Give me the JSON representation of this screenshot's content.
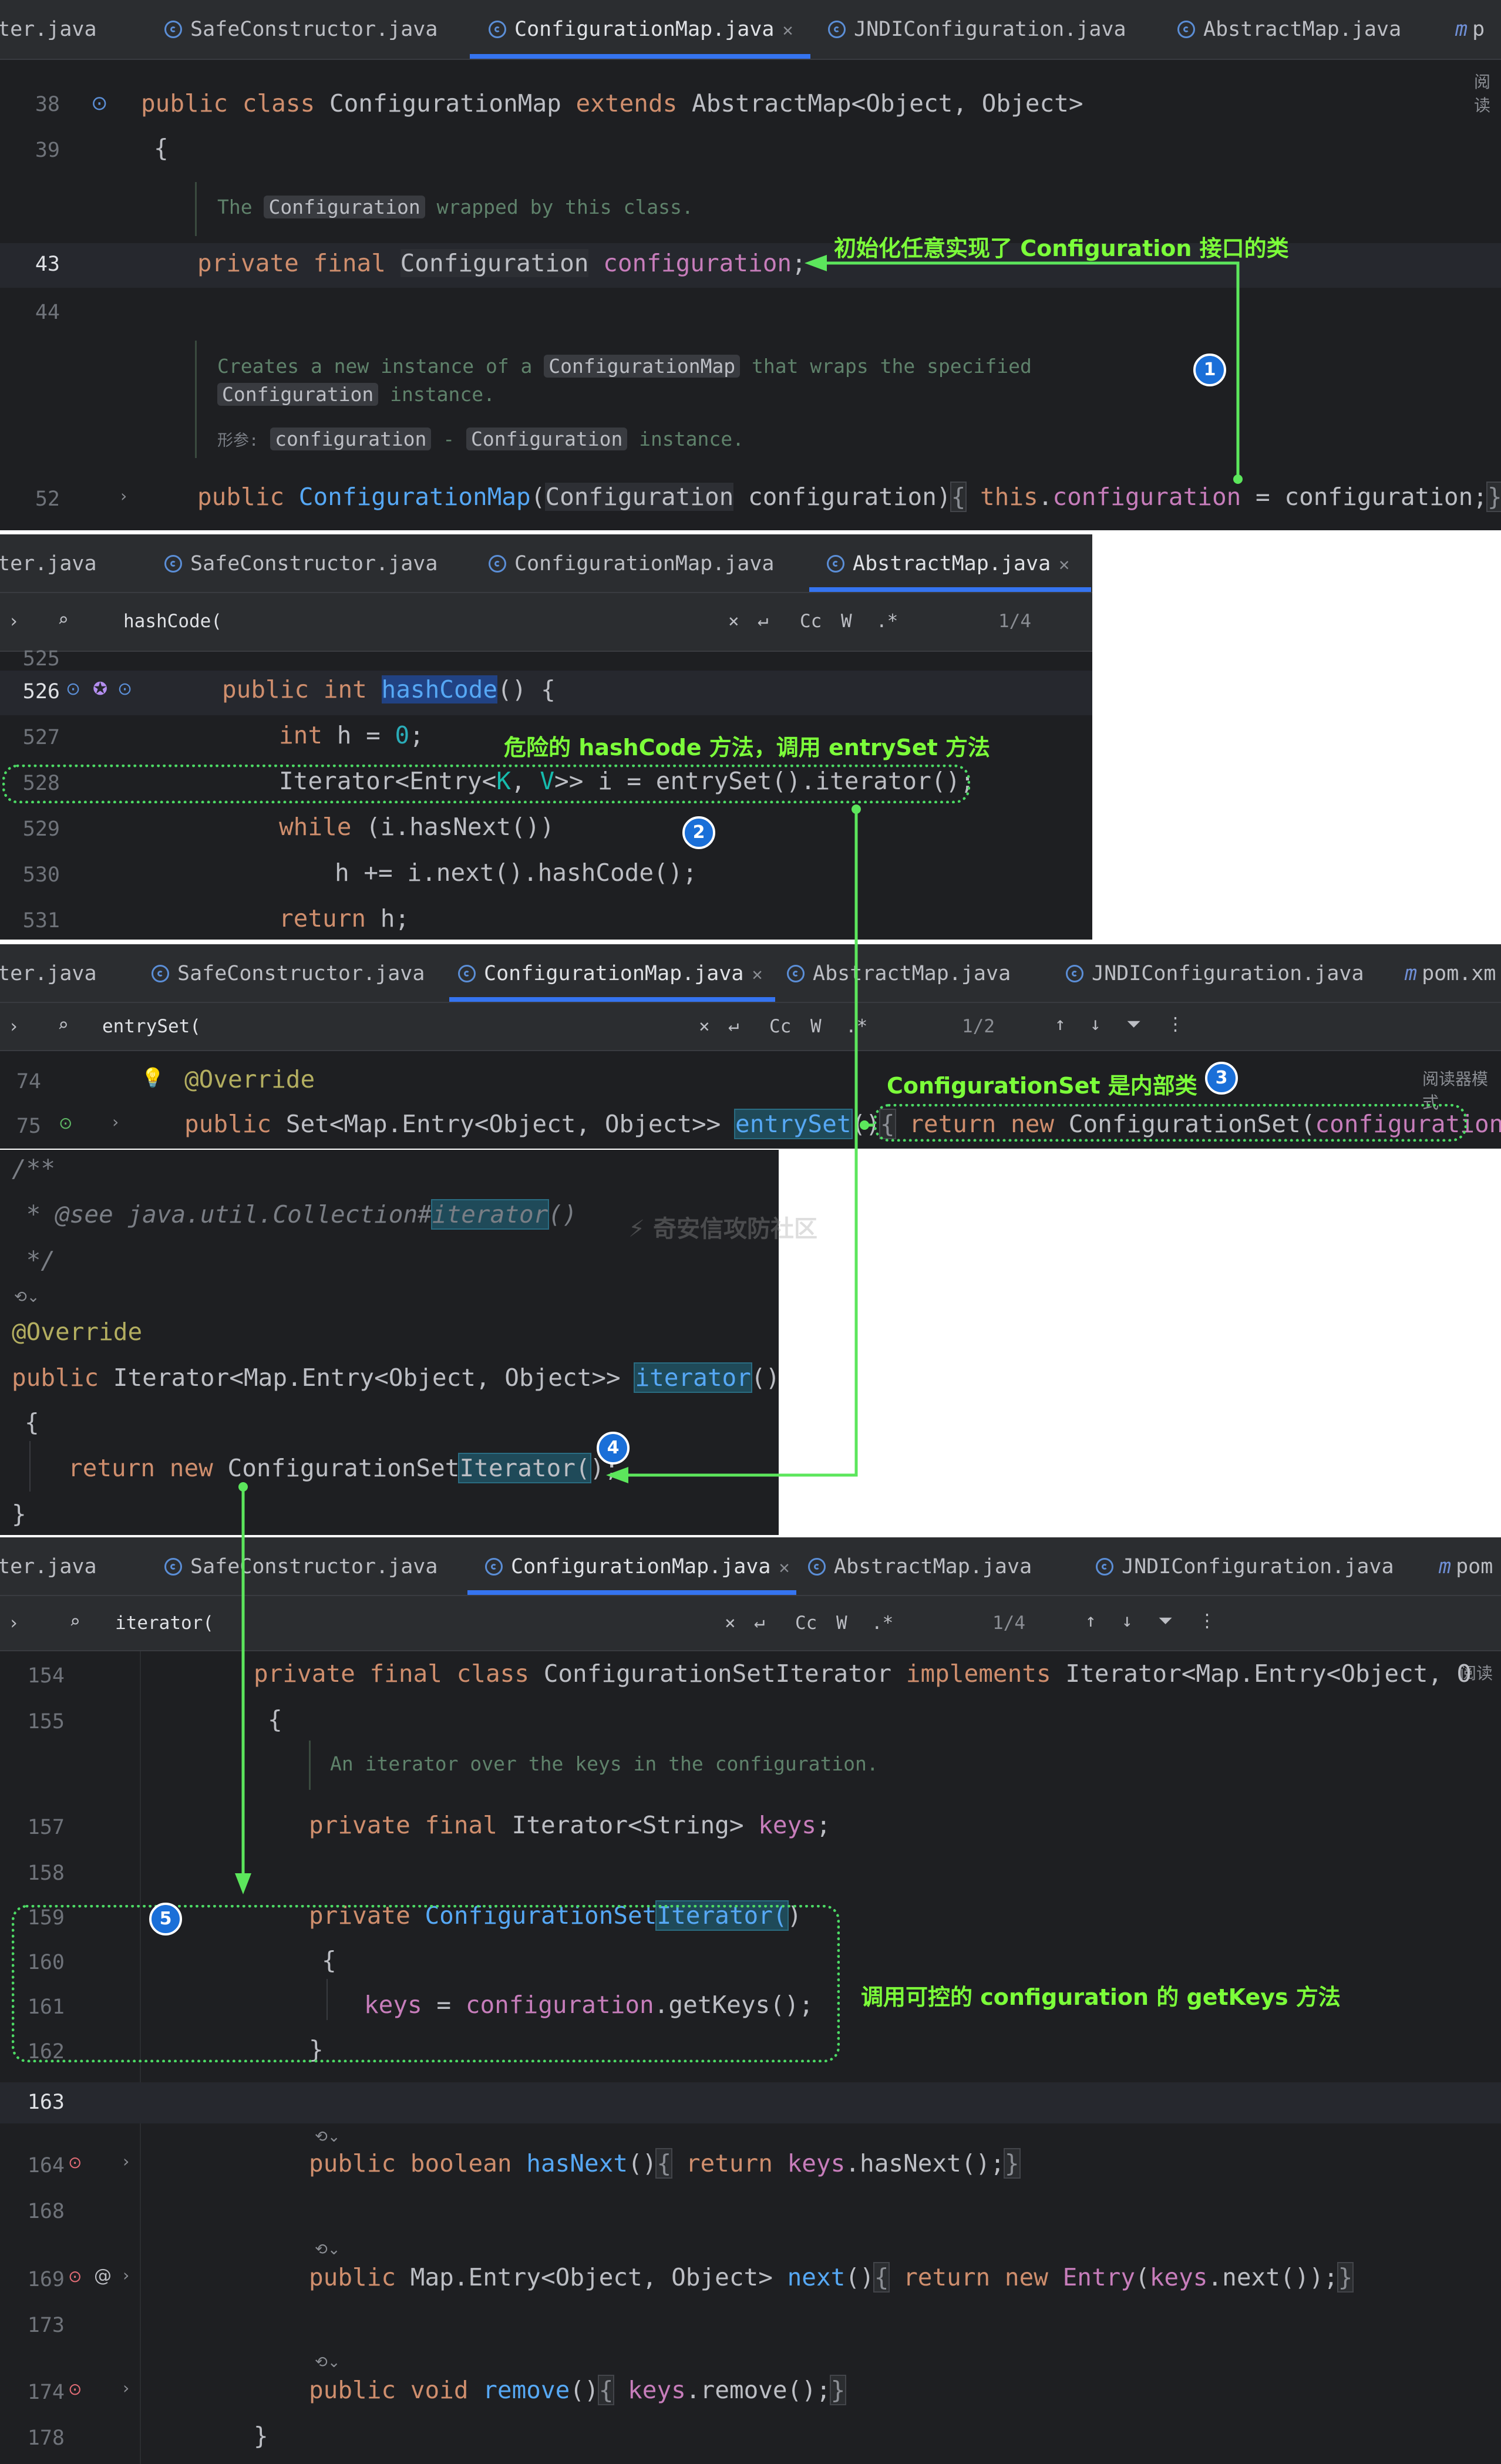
{
  "panel1": {
    "tabs": [
      "ter.java",
      "SafeConstructor.java",
      "ConfigurationMap.java",
      "JNDIConfiguration.java",
      "AbstractMap.java",
      "p"
    ],
    "tab_icon_m": "m",
    "right_hint": "阅读",
    "line_numbers": [
      "38",
      "39",
      "43",
      "44",
      "52"
    ],
    "doc1": {
      "pre": "The ",
      "chip": "Configuration",
      "post": " wrapped by this class."
    },
    "doc2": {
      "pre": "Creates a new instance of a ",
      "chip1": "ConfigurationMap",
      "mid": " that wraps the specified",
      "chip2": "Configuration",
      "post": " instance."
    },
    "doc3": {
      "param_label": "形参:",
      "chip1": "configuration",
      "dash": " - ",
      "chip2": "Configuration",
      "post": " instance."
    },
    "note": "初始化任意实现了 Configuration 接口的类",
    "badge": "1"
  },
  "panel2": {
    "tabs": [
      "ter.java",
      "SafeConstructor.java",
      "ConfigurationMap.java",
      "AbstractMap.java"
    ],
    "search_value": "hashCode(",
    "search_count": "1/4",
    "search_opts": [
      "Cc",
      "W",
      ".*"
    ],
    "line_numbers": [
      "525",
      "526",
      "527",
      "528",
      "529",
      "530",
      "531"
    ],
    "note": "危险的 hashCode 方法，调用 entrySet 方法",
    "badge": "2"
  },
  "panel3": {
    "tabs": [
      "ter.java",
      "SafeConstructor.java",
      "ConfigurationMap.java",
      "AbstractMap.java",
      "JNDIConfiguration.java",
      "pom.xm"
    ],
    "search_value": "entrySet(",
    "search_count": "1/2",
    "search_opts": [
      "Cc",
      "W",
      ".*"
    ],
    "line_numbers": [
      "74",
      "75"
    ],
    "note": "ConfigurationSet 是内部类",
    "badge": "3",
    "right_hint": "阅读器模式"
  },
  "panel4": {
    "watermark": "奇安信攻防社区",
    "badge": "4"
  },
  "panel5": {
    "tabs": [
      "ter.java",
      "SafeConstructor.java",
      "ConfigurationMap.java",
      "AbstractMap.java",
      "JNDIConfiguration.java",
      "pom"
    ],
    "search_value": "iterator(",
    "search_count": "1/4",
    "search_opts": [
      "Cc",
      "W",
      ".*"
    ],
    "line_numbers": [
      "154",
      "155",
      "157",
      "158",
      "159",
      "160",
      "161",
      "162",
      "163",
      "164",
      "168",
      "169",
      "173",
      "174",
      "178"
    ],
    "doc": "An iterator over the keys in the configuration.",
    "note": "调用可控的 configuration 的 getKeys 方法",
    "badge": "5",
    "right_hint": "阅读"
  },
  "colors": {
    "editor_bg": "#1e1f22",
    "tab_bg": "#2b2d30",
    "accent": "#3574f0",
    "annotation_green": "#7cff3a",
    "badge_blue": "#1a6fd8"
  }
}
